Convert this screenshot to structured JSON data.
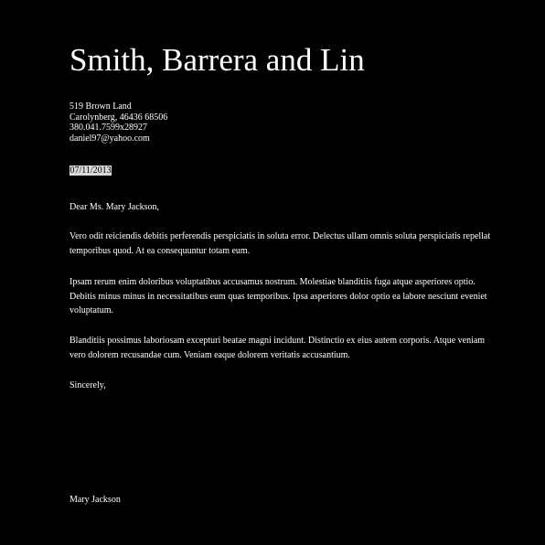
{
  "letterhead": {
    "company": "Smith, Barrera and Lin",
    "address_lines": [
      "519 Brown Land",
      "Carolynberg, 46436 68506",
      "380.041.7599x28927",
      "daniel97@yahoo.com"
    ]
  },
  "date": "07/11/2013",
  "salutation": "Dear Ms. Mary Jackson,",
  "paragraphs": [
    "Vero odit reiciendis debitis perferendis perspiciatis in soluta error. Delectus ullam omnis soluta perspiciatis repellat temporibus quod. At ea consequuntur totam eum.",
    "Ipsam rerum enim doloribus voluptatibus accusamus nostrum. Molestiae blanditiis fuga atque asperiores optio. Debitis minus minus in necessitatibus eum quas temporibus. Ipsa asperiores dolor optio ea labore nesciunt eveniet voluptatum.",
    "Blanditiis possimus laboriosam excepturi beatae magni incidunt. Distinctio ex eius autem corporis. Atque veniam vero dolorem recusandae cum. Veniam eaque dolorem veritatis accusantium."
  ],
  "closing": "Sincerely,",
  "signature": "Mary Jackson",
  "colors": {
    "background": "#000000",
    "text": "#ffffff",
    "date_highlight": "#d9d9d9"
  }
}
